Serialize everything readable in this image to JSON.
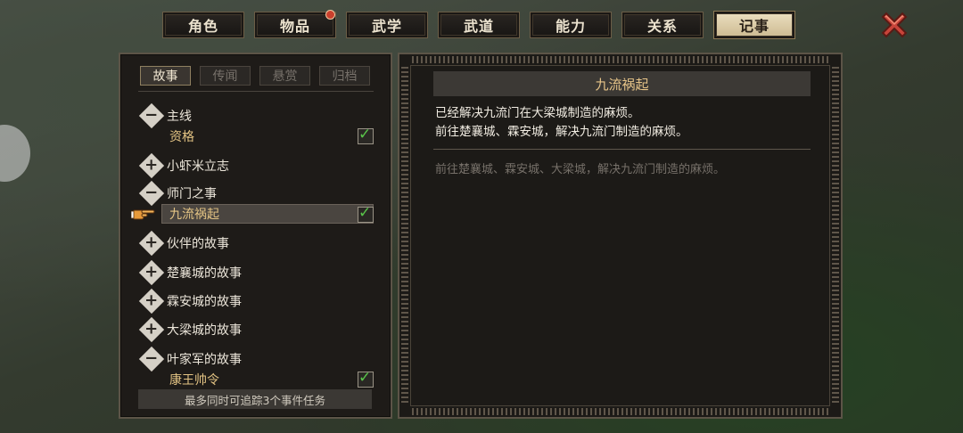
{
  "tabs": [
    {
      "label": "角色",
      "active": false,
      "badge": false
    },
    {
      "label": "物品",
      "active": false,
      "badge": true
    },
    {
      "label": "武学",
      "active": false,
      "badge": false
    },
    {
      "label": "武道",
      "active": false,
      "badge": false
    },
    {
      "label": "能力",
      "active": false,
      "badge": false
    },
    {
      "label": "关系",
      "active": false,
      "badge": false
    },
    {
      "label": "记事",
      "active": true,
      "badge": false
    }
  ],
  "subtabs": [
    "故事",
    "传闻",
    "悬赏",
    "归档"
  ],
  "tree": {
    "g1": {
      "label": "主线",
      "sign": "−"
    },
    "g1_item": {
      "label": "资格",
      "checked": true
    },
    "g2": {
      "label": "小虾米立志",
      "sign": "+"
    },
    "g3": {
      "label": "师门之事",
      "sign": "−"
    },
    "g3_item": {
      "label": "九流祸起",
      "checked": true
    },
    "g4": {
      "label": "伙伴的故事",
      "sign": "+"
    },
    "g5": {
      "label": "楚襄城的故事",
      "sign": "+"
    },
    "g6": {
      "label": "霖安城的故事",
      "sign": "+"
    },
    "g7": {
      "label": "大梁城的故事",
      "sign": "+"
    },
    "g8": {
      "label": "叶家军的故事",
      "sign": "−"
    },
    "g8_item": {
      "label": "康王帅令",
      "checked": true
    }
  },
  "footer": "最多同时可追踪3个事件任务",
  "detail": {
    "title": "九流祸起",
    "line1": "已经解决九流门在大梁城制造的麻烦。",
    "line2": "前往楚襄城、霖安城，解决九流门制造的麻烦。",
    "hint": "前往楚襄城、霖安城、大梁城，解决九流门制造的麻烦。"
  },
  "colors": {
    "accent": "#e6c488",
    "check": "#59c44a",
    "badge": "#c9402d"
  }
}
